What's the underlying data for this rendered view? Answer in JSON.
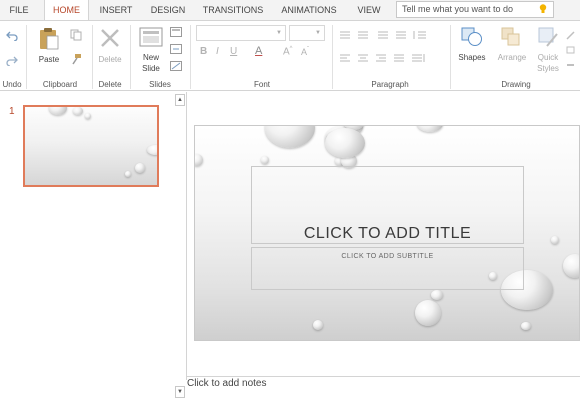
{
  "tabs": {
    "file": "FILE",
    "home": "HOME",
    "insert": "INSERT",
    "design": "DESIGN",
    "transitions": "TRANSITIONS",
    "animations": "ANIMATIONS",
    "view": "VIEW"
  },
  "tell_me": {
    "placeholder": "Tell me what you want to do"
  },
  "ribbon": {
    "groups": {
      "undo": "Undo",
      "clipboard": "Clipboard",
      "delete": "Delete",
      "slides": "Slides",
      "font": "Font",
      "paragraph": "Paragraph",
      "drawing": "Drawing"
    },
    "buttons": {
      "paste": "Paste",
      "delete": "Delete",
      "new_slide_line1": "New",
      "new_slide_line2": "Slide",
      "shapes": "Shapes",
      "arrange": "Arrange",
      "quick_styles_line1": "Quick",
      "quick_styles_line2": "Styles"
    }
  },
  "thumbnails": {
    "slide_number": "1"
  },
  "slide": {
    "title": "CLICK TO ADD TITLE",
    "subtitle": "CLICK TO ADD SUBTITLE"
  },
  "notes": {
    "placeholder": "Click to add notes"
  },
  "colors": {
    "accent": "#b7472a",
    "selection_border": "#e07b5a",
    "disabled": "#aaaaaa"
  }
}
